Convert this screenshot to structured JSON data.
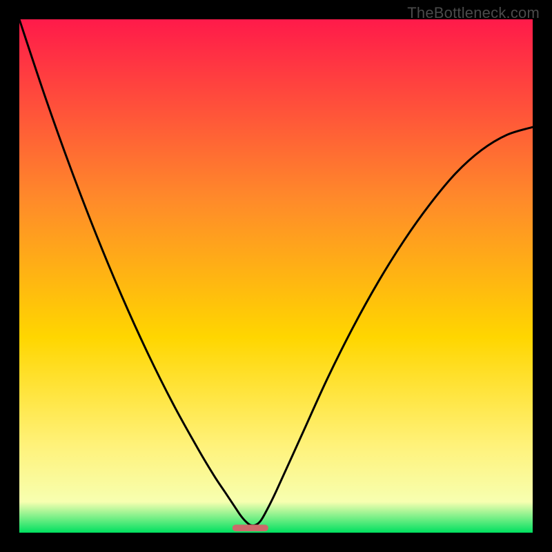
{
  "watermark": "TheBottleneck.com",
  "chart_data": {
    "type": "line",
    "title": "",
    "xlabel": "",
    "ylabel": "",
    "xlim": [
      0,
      100
    ],
    "ylim": [
      0,
      100
    ],
    "series": [
      {
        "name": "curve",
        "x": [
          0,
          5,
          10,
          15,
          20,
          25,
          30,
          35,
          38,
          40,
          42,
          43,
          44,
          45,
          46,
          47,
          48,
          50,
          55,
          60,
          65,
          70,
          75,
          80,
          85,
          90,
          95,
          100
        ],
        "values": [
          100,
          85,
          71,
          58,
          46,
          35,
          25,
          16,
          11,
          8,
          5,
          3.5,
          2.3,
          1.5,
          1.5,
          2.3,
          4,
          8,
          19,
          30,
          40,
          49,
          57,
          64,
          70,
          74.5,
          77.5,
          79
        ]
      }
    ],
    "gradient_top": "#ff1a4a",
    "gradient_mid1": "#ff8a2a",
    "gradient_mid2": "#ffd600",
    "gradient_low1": "#fff27a",
    "gradient_low2": "#f7ffb0",
    "gradient_bottom": "#00e060",
    "marker": {
      "x": 45,
      "color": "#cc6a6a",
      "width_frac": 0.07,
      "height_frac": 0.013
    }
  }
}
